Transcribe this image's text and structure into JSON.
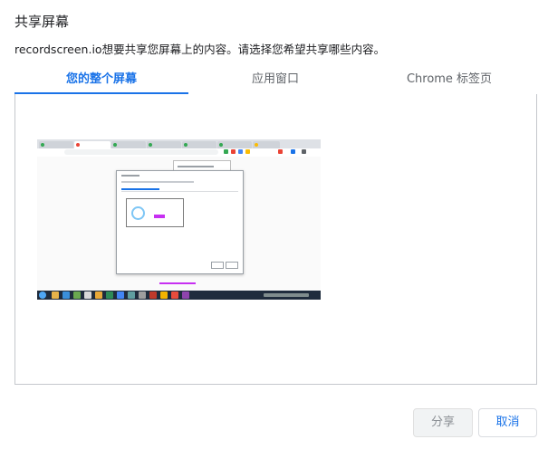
{
  "dialog": {
    "title": "共享屏幕",
    "description": "recordscreen.io想要共享您屏幕上的内容。请选择您希望共享哪些内容。"
  },
  "tabs": [
    {
      "label": "您的整个屏幕",
      "active": true
    },
    {
      "label": "应用窗口",
      "active": false
    },
    {
      "label": "Chrome 标签页",
      "active": false
    }
  ],
  "preview": {
    "name": "entire-screen-thumbnail"
  },
  "buttons": {
    "share_label": "分享",
    "cancel_label": "取消"
  },
  "colors": {
    "accent": "#1a73e8",
    "disabled_text": "#8c9095",
    "border": "#dadce0"
  }
}
